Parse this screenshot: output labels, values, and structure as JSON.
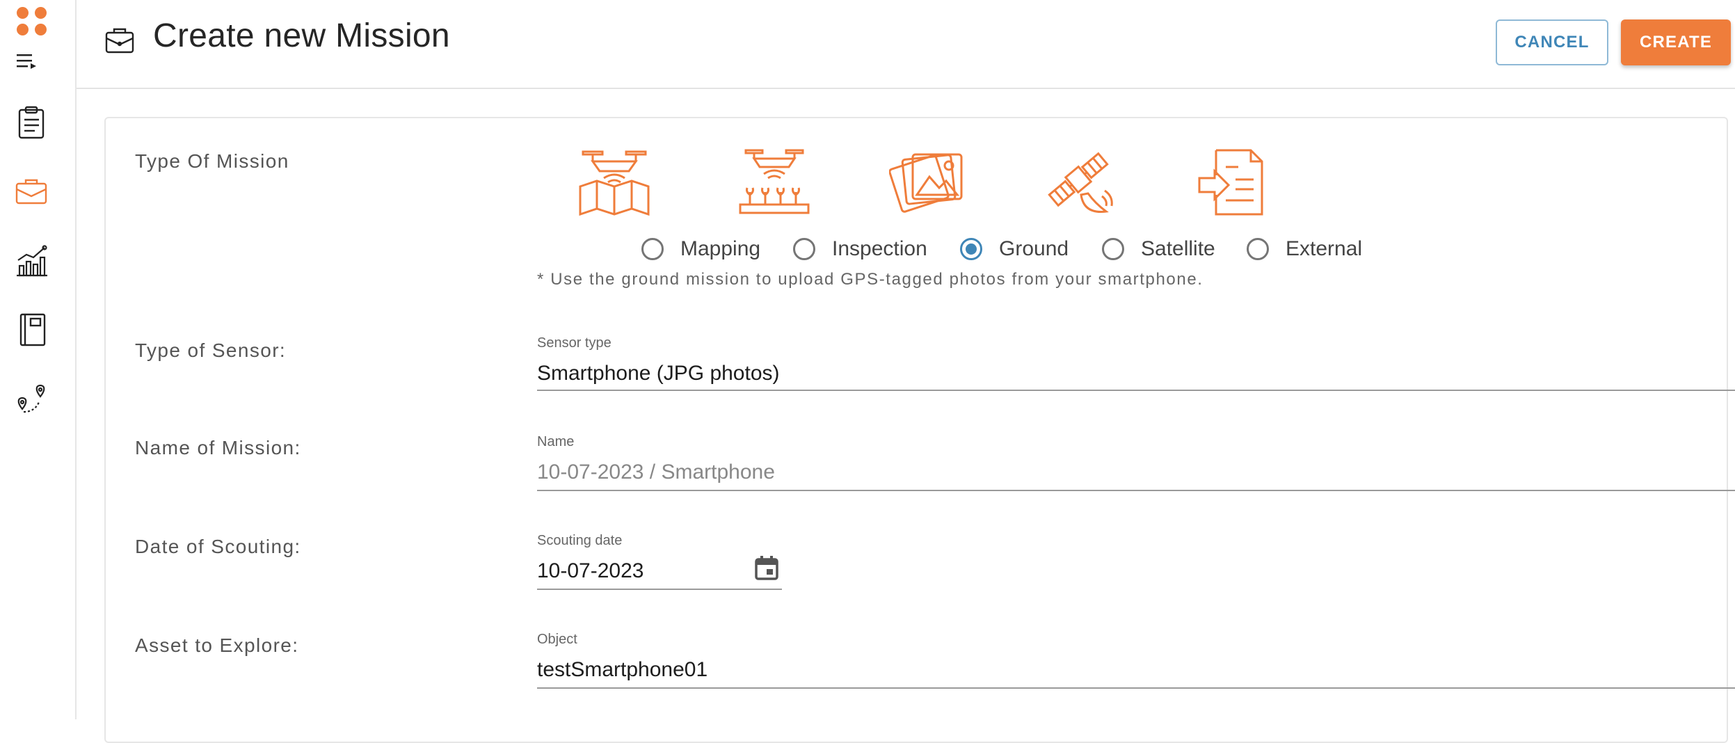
{
  "header": {
    "title": "Create new Mission",
    "cancel_label": "CANCEL",
    "create_label": "CREATE"
  },
  "sidebar": {
    "items": [
      {
        "icon": "clipboard-icon",
        "active": false
      },
      {
        "icon": "briefcase-icon",
        "active": true
      },
      {
        "icon": "chart-icon",
        "active": false
      },
      {
        "icon": "notebook-icon",
        "active": false
      },
      {
        "icon": "route-icon",
        "active": false
      }
    ]
  },
  "form": {
    "mission_type_label": "Type Of Mission",
    "mission_types": [
      {
        "label": "Mapping",
        "icon": "drone-map-icon",
        "checked": false
      },
      {
        "label": "Inspection",
        "icon": "drone-crops-icon",
        "checked": false
      },
      {
        "label": "Ground",
        "icon": "photos-icon",
        "checked": true
      },
      {
        "label": "Satellite",
        "icon": "satellite-icon",
        "checked": false
      },
      {
        "label": "External",
        "icon": "import-file-icon",
        "checked": false
      }
    ],
    "mission_hint": "* Use the ground mission to upload GPS-tagged photos from your smartphone.",
    "sensor_row_label": "Type of Sensor:",
    "sensor_field_label": "Sensor type",
    "sensor_value": "Smartphone (JPG photos)",
    "name_row_label": "Name of Mission:",
    "name_field_label": "Name",
    "name_placeholder": "10-07-2023 / Smartphone",
    "date_row_label": "Date of Scouting:",
    "date_field_label": "Scouting date",
    "date_value": "10-07-2023",
    "asset_row_label": "Asset to Explore:",
    "asset_field_label": "Object",
    "asset_value": "testSmartphone01"
  },
  "colors": {
    "accent_orange": "#ef7d3b",
    "accent_blue": "#3f86b7"
  }
}
